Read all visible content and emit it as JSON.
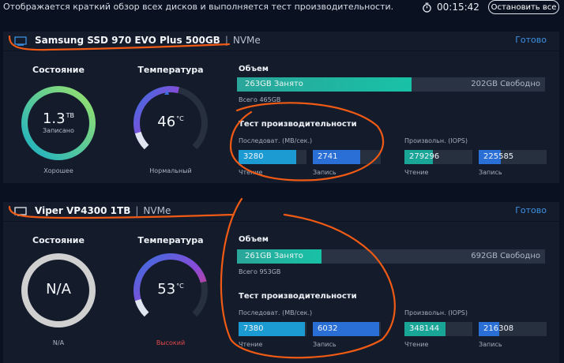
{
  "top": {
    "description": "Отображается краткий обзор всех дисков и выполняется тест производительности.",
    "timer": "00:15:42",
    "stop_all_label": "Остановить все"
  },
  "drives": [
    {
      "name": "Samsung SSD 970 EVO Plus 500GB",
      "separator": "|",
      "interface": "NVMe",
      "status": "Готово",
      "state_title": "Состояние",
      "state_value": "1.3",
      "state_unit": "TB",
      "state_sub": "Записано",
      "state_label": "Хорошее",
      "temp_title": "Температура",
      "temp_value": "46",
      "temp_unit": "°C",
      "temp_label": "Нормальный",
      "temp_level": 0.55,
      "volume_title": "Объем",
      "used": "263GB Занято",
      "free": "202GB Свободно",
      "used_fraction": 0.566,
      "total": "Всего 465GB",
      "perf_title": "Тест производительности",
      "seq_label": "Последоват. (MB/сек.)",
      "iops_label": "Произвольн. (IOPS)",
      "seq_read": "3280",
      "seq_write": "2741",
      "iops_read": "279296",
      "iops_write": "225585",
      "seq_read_level": 0.85,
      "seq_write_level": 0.7,
      "iops_read_level": 0.42,
      "iops_write_level": 0.32,
      "read_label": "Чтение",
      "write_label": "Запись",
      "state_colors": [
        "#1bb0c6",
        "#9be36a"
      ]
    },
    {
      "name": "Viper VP4300 1TB",
      "separator": "|",
      "interface": "NVMe",
      "status": "Готово",
      "state_title": "Состояние",
      "state_value": "N/A",
      "state_label": "N/A",
      "temp_title": "Температура",
      "temp_value": "53",
      "temp_unit": "°C",
      "temp_label": "Высокий",
      "temp_level": 0.78,
      "volume_title": "Объем",
      "used": "261GB Занято",
      "free": "692GB Свободно",
      "used_fraction": 0.274,
      "total": "Всего 953GB",
      "perf_title": "Тест производительности",
      "seq_label": "Последоват. (MB/сек.)",
      "iops_label": "Произвольн. (IOPS)",
      "seq_read": "7380",
      "seq_write": "6032",
      "iops_read": "348144",
      "iops_write": "216308",
      "seq_read_level": 0.98,
      "seq_write_level": 0.98,
      "iops_read_level": 0.6,
      "iops_write_level": 0.3,
      "read_label": "Чтение",
      "write_label": "Запись",
      "state_colors": [
        "#d0d0d0",
        "#d0d0d0"
      ]
    }
  ],
  "colors": {
    "background": "#0a1221",
    "card": "#141c2c",
    "accent_blue": "#3d8fe0",
    "used_fill": "#18c2a6",
    "annotation": "#f05a14",
    "hot": "#e24848"
  }
}
